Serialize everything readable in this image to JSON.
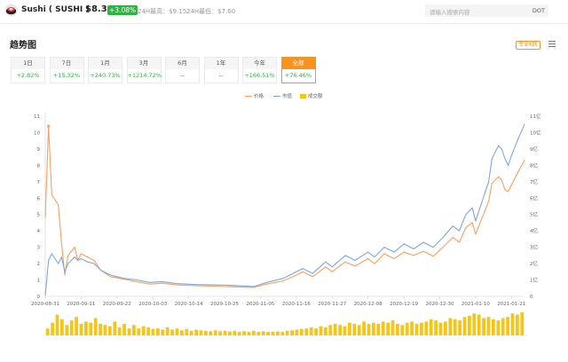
{
  "header": {
    "coin_name": "Sushi ( SUSHI )",
    "price": "$8.30",
    "change": "+3.08%",
    "high_label": "24H最高：$9.15",
    "low_label": "24H最低：$7.60",
    "search_placeholder": "请输入搜索内容",
    "search_keyword": "DOT"
  },
  "section": {
    "title": "趋势图",
    "pro_button": "专业K线",
    "menu_icon": "menu-icon"
  },
  "periods": [
    {
      "label": "1日",
      "value": "+2.82%",
      "state": "up"
    },
    {
      "label": "7日",
      "value": "+15.32%",
      "state": "up"
    },
    {
      "label": "1月",
      "value": "+240.73%",
      "state": "up"
    },
    {
      "label": "3月",
      "value": "+1214.72%",
      "state": "up"
    },
    {
      "label": "6月",
      "value": "--",
      "state": "neutral"
    },
    {
      "label": "1年",
      "value": "--",
      "state": "neutral"
    },
    {
      "label": "今年",
      "value": "+166.51%",
      "state": "up"
    },
    {
      "label": "全部",
      "value": "+76.46%",
      "state": "up",
      "active": true
    }
  ],
  "colors": {
    "price": "#f7a060",
    "market_cap": "#7fa6dd",
    "volume": "#f5c518",
    "up": "#2fb344",
    "accent": "#f7931e"
  },
  "chart_data": {
    "type": "line",
    "legend": [
      {
        "name": "价格",
        "color": "#f7a060",
        "marker": "line"
      },
      {
        "name": "市值",
        "color": "#7fa6dd",
        "marker": "line"
      },
      {
        "name": "成交额",
        "color": "#f5c518",
        "marker": "box"
      }
    ],
    "x_start": "2020-08-31",
    "x_end": "2021-01-25",
    "x_ticks": [
      "2020-08-31",
      "2020-09-11",
      "2020-09-22",
      "2020-10-03",
      "2020-10-14",
      "2020-10-25",
      "2020-11-05",
      "2020-11-16",
      "2020-11-27",
      "2020-12-08",
      "2020-12-19",
      "2020-12-30",
      "2021-01-10",
      "2021-01-21"
    ],
    "y_left": {
      "min": 0,
      "max": 11,
      "ticks": [
        "0",
        "1",
        "2",
        "3",
        "4",
        "5",
        "6",
        "7",
        "8",
        "9",
        "10",
        "11"
      ]
    },
    "y_right": {
      "min": 0,
      "max": 11,
      "ticks": [
        "0",
        "1亿",
        "2亿",
        "3亿",
        "4亿",
        "5亿",
        "6亿",
        "7亿",
        "8亿",
        "9亿",
        "10亿",
        "11亿"
      ]
    },
    "series": [
      {
        "name": "价格",
        "axis": "left",
        "points": [
          [
            "2020-08-31",
            4.8
          ],
          [
            "2020-09-01",
            10.4
          ],
          [
            "2020-09-02",
            6.2
          ],
          [
            "2020-09-04",
            5.6
          ],
          [
            "2020-09-05",
            3.2
          ],
          [
            "2020-09-06",
            1.3
          ],
          [
            "2020-09-07",
            2.5
          ],
          [
            "2020-09-09",
            3.0
          ],
          [
            "2020-09-10",
            2.2
          ],
          [
            "2020-09-11",
            2.6
          ],
          [
            "2020-09-13",
            2.4
          ],
          [
            "2020-09-15",
            2.2
          ],
          [
            "2020-09-17",
            1.6
          ],
          [
            "2020-09-20",
            1.2
          ],
          [
            "2020-09-24",
            1.05
          ],
          [
            "2020-09-28",
            0.9
          ],
          [
            "2020-10-02",
            0.75
          ],
          [
            "2020-10-06",
            0.8
          ],
          [
            "2020-10-10",
            0.7
          ],
          [
            "2020-10-16",
            0.65
          ],
          [
            "2020-10-22",
            0.62
          ],
          [
            "2020-10-28",
            0.58
          ],
          [
            "2020-11-03",
            0.55
          ],
          [
            "2020-11-07",
            0.75
          ],
          [
            "2020-11-12",
            0.95
          ],
          [
            "2020-11-16",
            1.3
          ],
          [
            "2020-11-18",
            1.5
          ],
          [
            "2020-11-21",
            1.2
          ],
          [
            "2020-11-25",
            1.8
          ],
          [
            "2020-11-27",
            1.5
          ],
          [
            "2020-12-01",
            2.1
          ],
          [
            "2020-12-04",
            1.85
          ],
          [
            "2020-12-08",
            2.3
          ],
          [
            "2020-12-10",
            2.0
          ],
          [
            "2020-12-13",
            2.6
          ],
          [
            "2020-12-16",
            2.3
          ],
          [
            "2020-12-19",
            2.7
          ],
          [
            "2020-12-22",
            2.5
          ],
          [
            "2020-12-25",
            2.75
          ],
          [
            "2020-12-28",
            2.45
          ],
          [
            "2020-12-31",
            3.0
          ],
          [
            "2021-01-03",
            3.6
          ],
          [
            "2021-01-05",
            3.3
          ],
          [
            "2021-01-07",
            4.2
          ],
          [
            "2021-01-09",
            4.5
          ],
          [
            "2021-01-10",
            3.8
          ],
          [
            "2021-01-12",
            4.8
          ],
          [
            "2021-01-13",
            5.3
          ],
          [
            "2021-01-14",
            5.8
          ],
          [
            "2021-01-15",
            6.9
          ],
          [
            "2021-01-17",
            7.3
          ],
          [
            "2021-01-18",
            7.1
          ],
          [
            "2021-01-19",
            6.5
          ],
          [
            "2021-01-20",
            6.4
          ],
          [
            "2021-01-21",
            6.8
          ],
          [
            "2021-01-23",
            7.6
          ],
          [
            "2021-01-25",
            8.3
          ]
        ]
      },
      {
        "name": "市值",
        "axis": "right",
        "points": [
          [
            "2020-08-31",
            0.05
          ],
          [
            "2020-09-01",
            2.2
          ],
          [
            "2020-09-02",
            2.6
          ],
          [
            "2020-09-04",
            2.0
          ],
          [
            "2020-09-05",
            2.4
          ],
          [
            "2020-09-06",
            1.5
          ],
          [
            "2020-09-07",
            2.0
          ],
          [
            "2020-09-09",
            2.4
          ],
          [
            "2020-09-10",
            2.2
          ],
          [
            "2020-09-11",
            2.3
          ],
          [
            "2020-09-13",
            2.1
          ],
          [
            "2020-09-15",
            2.0
          ],
          [
            "2020-09-17",
            1.6
          ],
          [
            "2020-09-20",
            1.3
          ],
          [
            "2020-09-24",
            1.1
          ],
          [
            "2020-09-28",
            1.0
          ],
          [
            "2020-10-02",
            0.85
          ],
          [
            "2020-10-06",
            0.9
          ],
          [
            "2020-10-10",
            0.78
          ],
          [
            "2020-10-16",
            0.72
          ],
          [
            "2020-10-22",
            0.7
          ],
          [
            "2020-10-28",
            0.66
          ],
          [
            "2020-11-03",
            0.6
          ],
          [
            "2020-11-07",
            0.85
          ],
          [
            "2020-11-12",
            1.1
          ],
          [
            "2020-11-16",
            1.5
          ],
          [
            "2020-11-18",
            1.7
          ],
          [
            "2020-11-21",
            1.4
          ],
          [
            "2020-11-25",
            2.1
          ],
          [
            "2020-11-27",
            1.8
          ],
          [
            "2020-12-01",
            2.5
          ],
          [
            "2020-12-04",
            2.2
          ],
          [
            "2020-12-08",
            2.7
          ],
          [
            "2020-12-10",
            2.4
          ],
          [
            "2020-12-13",
            3.0
          ],
          [
            "2020-12-16",
            2.7
          ],
          [
            "2020-12-19",
            3.2
          ],
          [
            "2020-12-22",
            2.9
          ],
          [
            "2020-12-25",
            3.3
          ],
          [
            "2020-12-28",
            3.0
          ],
          [
            "2020-12-31",
            3.6
          ],
          [
            "2021-01-03",
            4.3
          ],
          [
            "2021-01-05",
            4.0
          ],
          [
            "2021-01-07",
            5.0
          ],
          [
            "2021-01-09",
            5.4
          ],
          [
            "2021-01-10",
            4.6
          ],
          [
            "2021-01-12",
            5.8
          ],
          [
            "2021-01-13",
            6.4
          ],
          [
            "2021-01-14",
            7.0
          ],
          [
            "2021-01-15",
            8.4
          ],
          [
            "2021-01-17",
            9.2
          ],
          [
            "2021-01-18",
            9.0
          ],
          [
            "2021-01-19",
            8.4
          ],
          [
            "2021-01-20",
            8.0
          ],
          [
            "2021-01-21",
            8.6
          ],
          [
            "2021-01-23",
            9.6
          ],
          [
            "2021-01-25",
            10.5
          ]
        ]
      }
    ],
    "volume": [
      0.3,
      0.55,
      0.9,
      0.7,
      0.45,
      0.65,
      0.8,
      0.5,
      0.6,
      0.55,
      0.75,
      0.5,
      0.45,
      0.4,
      0.6,
      0.35,
      0.5,
      0.3,
      0.45,
      0.3,
      0.4,
      0.35,
      0.28,
      0.3,
      0.25,
      0.35,
      0.25,
      0.3,
      0.22,
      0.28,
      0.2,
      0.25,
      0.22,
      0.2,
      0.18,
      0.22,
      0.18,
      0.2,
      0.17,
      0.2,
      0.15,
      0.18,
      0.16,
      0.2,
      0.15,
      0.18,
      0.15,
      0.16,
      0.17,
      0.15,
      0.2,
      0.22,
      0.25,
      0.28,
      0.3,
      0.35,
      0.3,
      0.4,
      0.35,
      0.45,
      0.5,
      0.45,
      0.4,
      0.55,
      0.5,
      0.45,
      0.6,
      0.5,
      0.55,
      0.5,
      0.6,
      0.55,
      0.65,
      0.5,
      0.45,
      0.55,
      0.6,
      0.5,
      0.55,
      0.6,
      0.7,
      0.65,
      0.55,
      0.6,
      0.75,
      0.7,
      0.65,
      0.8,
      0.85,
      0.95,
      0.9,
      0.75,
      0.8,
      0.7,
      0.65,
      0.75,
      0.8,
      0.95,
      0.9,
      1.0
    ]
  }
}
